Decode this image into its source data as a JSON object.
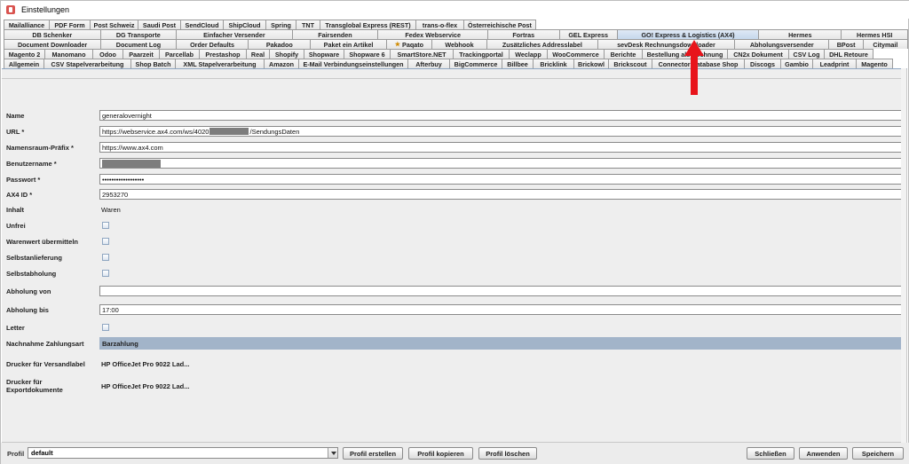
{
  "window": {
    "title": "Einstellungen"
  },
  "tabs": {
    "row1": [
      {
        "label": "Mailalliance",
        "w": 52
      },
      {
        "label": "PDF Form",
        "w": 47
      },
      {
        "label": "Post Schweiz",
        "w": 55
      },
      {
        "label": "Saudi Post",
        "w": 49
      },
      {
        "label": "SendCloud",
        "w": 49
      },
      {
        "label": "ShipCloud",
        "w": 49
      },
      {
        "label": "Spring",
        "w": 35
      },
      {
        "label": "TNT",
        "w": 28
      },
      {
        "label": "Transglobal Express (REST)",
        "w": 109
      },
      {
        "label": "trans-o-flex",
        "w": 55
      },
      {
        "label": "Österreichische Post",
        "w": 82
      }
    ],
    "row2": [
      {
        "label": "DB Schenker",
        "w": 128
      },
      {
        "label": "DG Transporte",
        "w": 101
      },
      {
        "label": "Einfacher Versender",
        "w": 154
      },
      {
        "label": "Fairsenden",
        "w": 114
      },
      {
        "label": "Fedex Webservice",
        "w": 146
      },
      {
        "label": "Fortras",
        "w": 95
      },
      {
        "label": "GEL Express",
        "w": 77
      },
      {
        "label": "GO! Express & Logistics (AX4)",
        "w": 188,
        "selected": true
      },
      {
        "label": "Hermes",
        "w": 110
      },
      {
        "label": "Hermes HSI",
        "w": 88
      }
    ],
    "row3": [
      {
        "label": "Document Downloader",
        "w": 112
      },
      {
        "label": "Document Log",
        "w": 87
      },
      {
        "label": "Order Defaults",
        "w": 84
      },
      {
        "label": "Pakadoo",
        "w": 72
      },
      {
        "label": "Paket ein Artikel",
        "w": 88
      },
      {
        "label": "Paqato",
        "w": 53,
        "star": true
      },
      {
        "label": "Webhook",
        "w": 64
      },
      {
        "label": "Zusätzliches Addresslabel",
        "w": 128
      },
      {
        "label": "sevDesk Rechnungsdownloader",
        "w": 158
      },
      {
        "label": "Abholungsversender",
        "w": 109
      },
      {
        "label": "BPost",
        "w": 40
      },
      {
        "label": "Citymail",
        "w": 52
      }
    ],
    "row4": [
      {
        "label": "Magento 2",
        "w": 47
      },
      {
        "label": "Manomano",
        "w": 55
      },
      {
        "label": "Odoo",
        "w": 35
      },
      {
        "label": "Paarzeit",
        "w": 42
      },
      {
        "label": "Parcellab",
        "w": 46
      },
      {
        "label": "Prestashop",
        "w": 54
      },
      {
        "label": "Real",
        "w": 27
      },
      {
        "label": "Shopify",
        "w": 40
      },
      {
        "label": "Shopware",
        "w": 46
      },
      {
        "label": "Shopware 6",
        "w": 53
      },
      {
        "label": "SmartStore.NET",
        "w": 72
      },
      {
        "label": "Trackingportal",
        "w": 64
      },
      {
        "label": "Weclapp",
        "w": 44
      },
      {
        "label": "WooCommerce",
        "w": 65
      },
      {
        "label": "Berichte",
        "w": 44
      },
      {
        "label": "Bestellung als Rechnung",
        "w": 97
      },
      {
        "label": "CN2x Dokument",
        "w": 70
      },
      {
        "label": "CSV Log",
        "w": 41
      },
      {
        "label": "DHL Retoure",
        "w": 56
      }
    ],
    "row5": [
      {
        "label": "Allgemein",
        "w": 46
      },
      {
        "label": "CSV Stapelverarbeitung",
        "w": 99
      },
      {
        "label": "Shop Batch",
        "w": 51
      },
      {
        "label": "XML Stapelverarbeitung",
        "w": 101
      },
      {
        "label": "Amazon",
        "w": 40
      },
      {
        "label": "E-Mail Verbindungseinstellungen",
        "w": 124
      },
      {
        "label": "Afterbuy",
        "w": 48
      },
      {
        "label": "BigCommerce",
        "w": 60
      },
      {
        "label": "Billbee",
        "w": 36
      },
      {
        "label": "Bricklink",
        "w": 47
      },
      {
        "label": "Brickowl",
        "w": 40
      },
      {
        "label": "Brickscout",
        "w": 50
      },
      {
        "label": "Connector Database Shop",
        "w": 105
      },
      {
        "label": "Discogs",
        "w": 42
      },
      {
        "label": "Gambio",
        "w": 37
      },
      {
        "label": "Leadprint",
        "w": 50
      },
      {
        "label": "Magento",
        "w": 42
      }
    ]
  },
  "form": {
    "name_label": "Name",
    "name_value": "generalovernight",
    "url_label": "URL *",
    "url_prefix": "https://webservice.ax4.com/ws/4020",
    "url_suffix": "/SendungsDaten",
    "ns_label": "Namensraum-Präfix *",
    "ns_value": "https://www.ax4.com",
    "user_label": "Benutzername *",
    "password_label": "Passwort *",
    "password_value": "••••••••••••••••••",
    "ax4_label": "AX4 ID *",
    "ax4_value": "2953270",
    "inhalt_label": "Inhalt",
    "inhalt_value": "Waren",
    "unfrei_label": "Unfrei",
    "warenwert_label": "Warenwert übermitteln",
    "selbstanlieferung_label": "Selbstanlieferung",
    "selbstabholung_label": "Selbstabholung",
    "abholung_von_label": "Abholung von",
    "abholung_von_value": "",
    "abholung_bis_label": "Abholung bis",
    "abholung_bis_value": "17:00",
    "letter_label": "Letter",
    "nachnahme_label": "Nachnahme Zahlungsart",
    "nachnahme_value": "Barzahlung",
    "drucker_versand_label": "Drucker für Versandlabel",
    "drucker_versand_value": "HP OfficeJet Pro 9022 Lad...",
    "drucker_export_label": "Drucker für Exportdokumente",
    "drucker_export_value": "HP OfficeJet Pro 9022 Lad..."
  },
  "footer": {
    "profil_label": "Profil",
    "profil_value": "default",
    "create_label": "Profil erstellen",
    "copy_label": "Profil kopieren",
    "delete_label": "Profil löschen",
    "close_label": "Schließen",
    "apply_label": "Anwenden",
    "save_label": "Speichern"
  },
  "colors": {
    "selected_tab": "#c5d7ec",
    "combo_bg": "#a2b4c9",
    "arrow": "#e8141b"
  }
}
